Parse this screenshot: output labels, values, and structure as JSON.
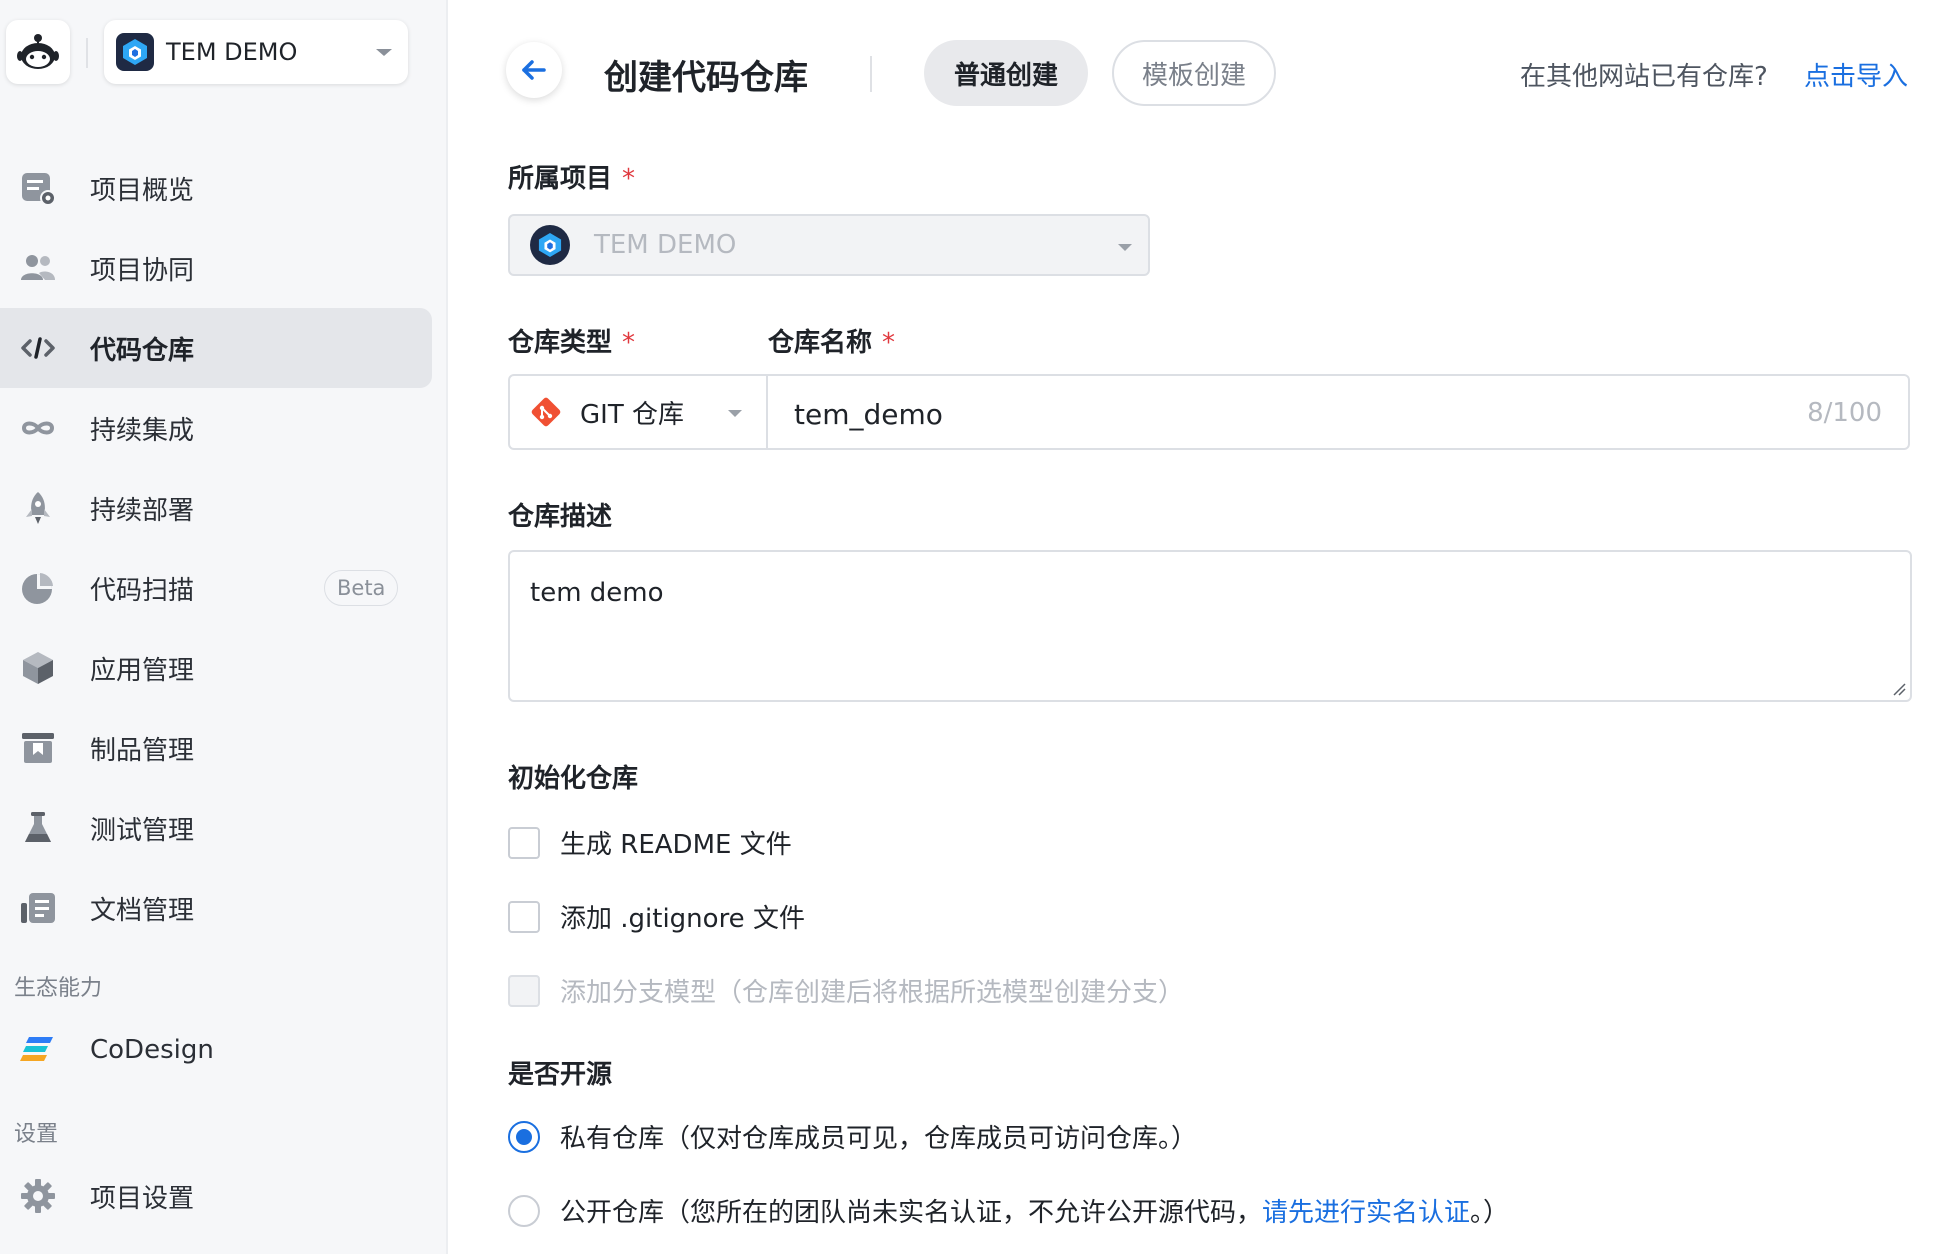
{
  "sidebar": {
    "project_name": "TEM DEMO",
    "items": [
      {
        "label": "项目概览",
        "icon": "overview-icon"
      },
      {
        "label": "项目协同",
        "icon": "members-icon"
      },
      {
        "label": "代码仓库",
        "icon": "code-icon",
        "active": true
      },
      {
        "label": "持续集成",
        "icon": "infinity-icon"
      },
      {
        "label": "持续部署",
        "icon": "rocket-icon"
      },
      {
        "label": "代码扫描",
        "icon": "pie-scan-icon",
        "badge": "Beta"
      },
      {
        "label": "应用管理",
        "icon": "cube-icon"
      },
      {
        "label": "制品管理",
        "icon": "archive-icon"
      },
      {
        "label": "测试管理",
        "icon": "flask-icon"
      },
      {
        "label": "文档管理",
        "icon": "document-icon"
      }
    ],
    "eco_section": "生态能力",
    "eco_items": [
      {
        "label": "CoDesign",
        "icon": "codesign-icon"
      }
    ],
    "settings_section": "设置",
    "settings_items": [
      {
        "label": "项目设置",
        "icon": "gear-icon"
      }
    ]
  },
  "header": {
    "title": "创建代码仓库",
    "tabs": [
      {
        "label": "普通创建",
        "active": true
      },
      {
        "label": "模板创建",
        "active": false
      }
    ],
    "import_prompt": "在其他网站已有仓库?",
    "import_link": "点击导入"
  },
  "form": {
    "project": {
      "label": "所属项目",
      "required": "*",
      "value": "TEM DEMO"
    },
    "repo_type": {
      "label": "仓库类型",
      "required": "*",
      "value": "GIT 仓库"
    },
    "repo_name": {
      "label": "仓库名称",
      "required": "*",
      "value": "tem_demo",
      "counter": "8/100"
    },
    "description": {
      "label": "仓库描述",
      "value": "tem demo"
    },
    "init": {
      "label": "初始化仓库",
      "options": [
        {
          "label": "生成 README 文件",
          "checked": false,
          "disabled": false
        },
        {
          "label": "添加 .gitignore 文件",
          "checked": false,
          "disabled": false
        },
        {
          "label": "添加分支模型（仓库创建后将根据所选模型创建分支）",
          "checked": false,
          "disabled": true
        }
      ]
    },
    "visibility": {
      "label": "是否开源",
      "private": {
        "label": "私有仓库（仅对仓库成员可见，仓库成员可访问仓库。）",
        "checked": true
      },
      "public": {
        "label_prefix": "公开仓库（您所在的团队尚未实名认证，不允许公开源代码，",
        "link": "请先进行实名认证",
        "label_suffix": "。）",
        "checked": false
      }
    }
  },
  "colors": {
    "accent": "#1a6fe0",
    "required": "#e0383e",
    "git": "#f05033"
  }
}
